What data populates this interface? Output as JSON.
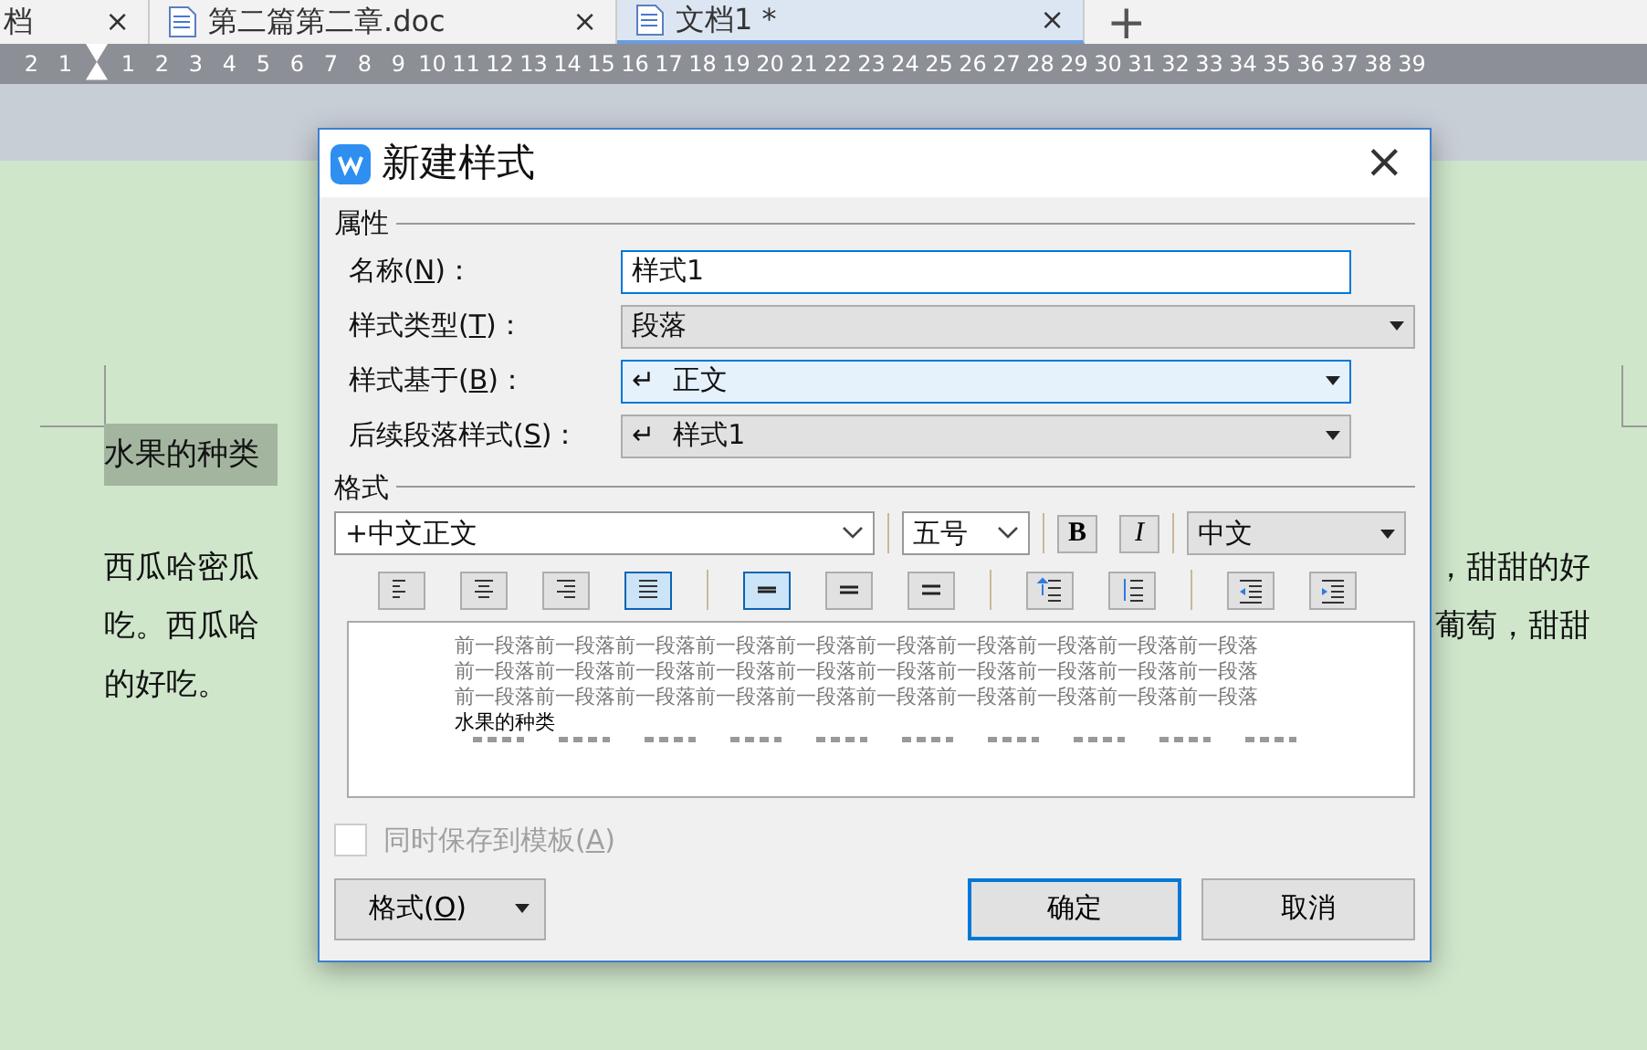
{
  "tabs": [
    {
      "label": "档",
      "kind": "plain",
      "selected": false,
      "close": "×"
    },
    {
      "label": "第二篇第二章.doc",
      "kind": "doc",
      "selected": false,
      "close": "×"
    },
    {
      "label": "文档1 *",
      "kind": "doc",
      "selected": true,
      "close": "×"
    }
  ],
  "new_tab": "+",
  "ruler": [
    "2",
    "1",
    "1",
    "2",
    "3",
    "4",
    "5",
    "6",
    "7",
    "8",
    "9",
    "10",
    "11",
    "12",
    "13",
    "14",
    "15",
    "16",
    "17",
    "18",
    "19",
    "20",
    "21",
    "22",
    "23",
    "24",
    "25",
    "26",
    "27",
    "28",
    "29",
    "30",
    "31",
    "32",
    "33",
    "34",
    "35",
    "36",
    "37",
    "38",
    "39"
  ],
  "document": {
    "heading": "水果的种类",
    "lines": [
      {
        "left": "西瓜哈密瓜",
        "right": "，甜甜的好"
      },
      {
        "left": "吃。西瓜哈",
        "right": "葡萄，甜甜"
      },
      {
        "left": "的好吃。"
      }
    ]
  },
  "dialog": {
    "title": "新建样式",
    "close": "×",
    "properties": {
      "heading": "属性",
      "fields": [
        {
          "kind": "text",
          "before": "名称(",
          "key": "N",
          "after": ")：",
          "value": "样式1",
          "focused": false
        },
        {
          "kind": "select",
          "before": "样式类型(",
          "key": "T",
          "after": ")：",
          "value": "段落",
          "focused": false,
          "wide": true
        },
        {
          "kind": "select",
          "before": "样式基于(",
          "key": "B",
          "after": ")：",
          "mark": "↵",
          "value": "正文",
          "focused": true
        },
        {
          "kind": "select",
          "before": "后续段落样式(",
          "key": "S",
          "after": ")：",
          "mark": "↵",
          "value": "样式1",
          "focused": false
        }
      ]
    },
    "format": {
      "heading": "格式",
      "font": "+中文正文",
      "size": "五号",
      "bold": "B",
      "italic": "I",
      "script": "中文",
      "tools": [
        {
          "kind": "align-left",
          "selected": false
        },
        {
          "kind": "align-center",
          "selected": false
        },
        {
          "kind": "align-right",
          "selected": false
        },
        {
          "kind": "align-justify",
          "selected": true
        },
        {
          "kind": "spacing-single",
          "separator_before": true,
          "selected": true
        },
        {
          "kind": "spacing-one-half",
          "selected": false
        },
        {
          "kind": "spacing-double",
          "selected": false
        },
        {
          "kind": "space-increase",
          "separator_before": true,
          "selected": false
        },
        {
          "kind": "space-decrease",
          "selected": false
        },
        {
          "kind": "indent-decrease",
          "separator_before": true,
          "selected": false
        },
        {
          "kind": "indent-increase",
          "selected": false
        }
      ],
      "preview": {
        "previous": [
          "前一段落前一段落前一段落前一段落前一段落前一段落前一段落前一段落前一段落前一段落",
          "前一段落前一段落前一段落前一段落前一段落前一段落前一段落前一段落前一段落前一段落",
          "前一段落前一段落前一段落前一段落前一段落前一段落前一段落前一段落前一段落前一段落"
        ],
        "sample": "水果的种类"
      }
    },
    "template": {
      "before": "同时保存到模板(",
      "key": "A",
      "after": ")",
      "checked": false,
      "disabled": true
    },
    "format_menu": {
      "before": "格式(",
      "key": "O",
      "after": ")"
    },
    "buttons": [
      {
        "label": "确定",
        "default": true
      },
      {
        "label": "取消",
        "default": false
      }
    ]
  }
}
